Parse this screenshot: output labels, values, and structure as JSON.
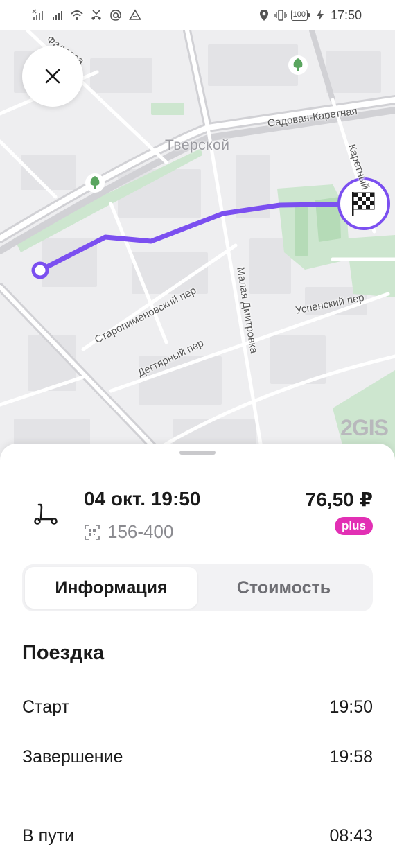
{
  "status_bar": {
    "time": "17:50",
    "battery": "100"
  },
  "map": {
    "district": "Тверской",
    "streets": {
      "fadeeva": "Фадеева",
      "sadovaya": "Садовая-Каретная",
      "karetny": "Каретный",
      "staropimenovsky": "Старопименовский пер",
      "malaya_dmitrovka": "Малая Дмитровка",
      "degtyarny": "Дегтярный пер",
      "uspensky": "Успенский пер"
    },
    "provider": "2GIS",
    "route_color": "#7b4ff0"
  },
  "ride": {
    "date": "04 окт. 19:50",
    "scooter_id": "156-400",
    "price": "76,50 ₽",
    "badge": "plus",
    "badge_color": "#e230b4"
  },
  "tabs": [
    {
      "label": "Информация",
      "active": true
    },
    {
      "label": "Стоимость",
      "active": false
    }
  ],
  "trip": {
    "title": "Поездка",
    "rows": [
      {
        "label": "Старт",
        "value": "19:50"
      },
      {
        "label": "Завершение",
        "value": "19:58"
      },
      {
        "label": "В пути",
        "value": "08:43"
      }
    ]
  }
}
